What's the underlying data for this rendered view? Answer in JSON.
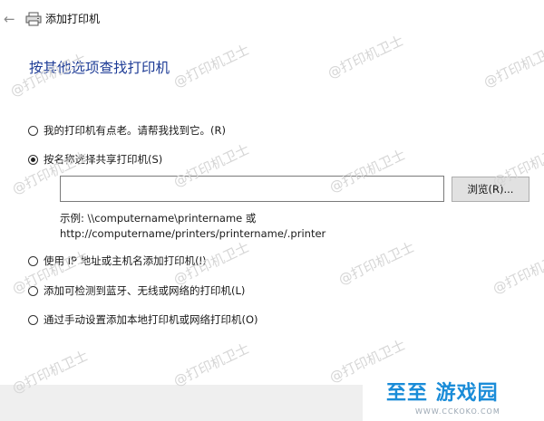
{
  "window": {
    "title": "添加打印机",
    "back_glyph": "←"
  },
  "page": {
    "heading": "按其他选项查找打印机"
  },
  "options": [
    {
      "label": "我的打印机有点老。请帮我找到它。(R)",
      "checked": false
    },
    {
      "label": "按名称选择共享打印机(S)",
      "checked": true
    },
    {
      "label": "使用 IP 地址或主机名添加打印机(I)",
      "checked": false
    },
    {
      "label": "添加可检测到蓝牙、无线或网络的打印机(L)",
      "checked": false
    },
    {
      "label": "通过手动设置添加本地打印机或网络打印机(O)",
      "checked": false
    }
  ],
  "share": {
    "input_value": "",
    "browse_label": "浏览(R)...",
    "example_line1": "示例: \\\\computername\\printername 或",
    "example_line2": "http://computername/printers/printername/.printer"
  },
  "watermark": {
    "text": "@打印机卫士"
  },
  "logo": {
    "text": "至至 游戏园",
    "url": "WWW.CCKOKO.COM"
  }
}
